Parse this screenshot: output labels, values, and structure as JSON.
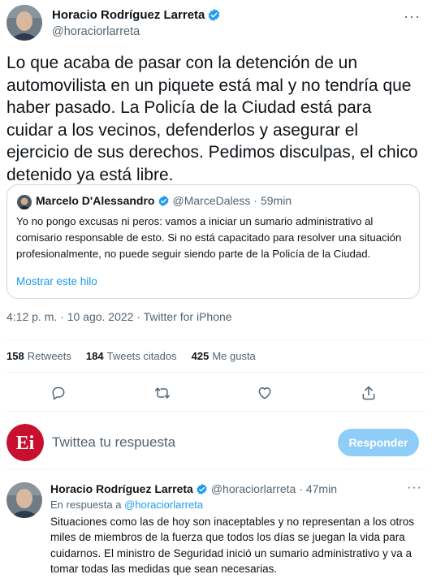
{
  "main_tweet": {
    "author_name": "Horacio Rodríguez Larreta",
    "author_handle": "@horaciorlarreta",
    "more_icon": "ellipsis-icon",
    "text": "Lo que acaba de pasar con la detención de un automovilista en un piquete está mal y no tendría que haber pasado. La Policía de la Ciudad está para cuidar a los vecinos, defenderlos y asegurar el ejercicio de sus derechos. Pedimos disculpas, el chico detenido ya está libre.",
    "timestamp": "4:12 p. m. · 10 ago. 2022 · Twitter for iPhone"
  },
  "quoted_tweet": {
    "author_name": "Marcelo D'Alessandro",
    "author_handle": "@MarceDaless",
    "time": "· 59min",
    "text": "Yo no pongo excusas ni peros: vamos a iniciar un sumario administrativo al comisario responsable de esto. Si no está capacitado para resolver una situación profesionalmente, no puede seguir siendo parte de la Policía de la Ciudad.",
    "thread_link": "Mostrar este hilo"
  },
  "stats": {
    "retweets_count": "158",
    "retweets_label": "Retweets",
    "quotes_count": "184",
    "quotes_label": "Tweets citados",
    "likes_count": "425",
    "likes_label": "Me gusta"
  },
  "actions": {
    "icons": [
      "reply-icon",
      "retweet-icon",
      "like-icon",
      "share-icon"
    ]
  },
  "reply_box": {
    "avatar_text": "Ei",
    "placeholder": "Twittea tu respuesta",
    "button_label": "Responder"
  },
  "reply_tweet": {
    "author_name": "Horacio Rodríguez Larreta",
    "author_handle": "@horaciorlarreta",
    "time": "· 47min",
    "in_reply_prefix": "En respuesta a",
    "in_reply_handle": "@horaciorlarreta",
    "text": "Situaciones como las de hoy son inaceptables y no representan a los otros miles de miembros de la fuerza que todos los días se juegan la vida para cuidarnos. El ministro de Seguridad inició un sumario administrativo y va a tomar todas las medidas que sean necesarias."
  },
  "colors": {
    "accent": "#1d9bf0",
    "secondary_text": "#536471",
    "reply_button_disabled": "#8ecdf8",
    "ei_brand": "#c8102e"
  }
}
